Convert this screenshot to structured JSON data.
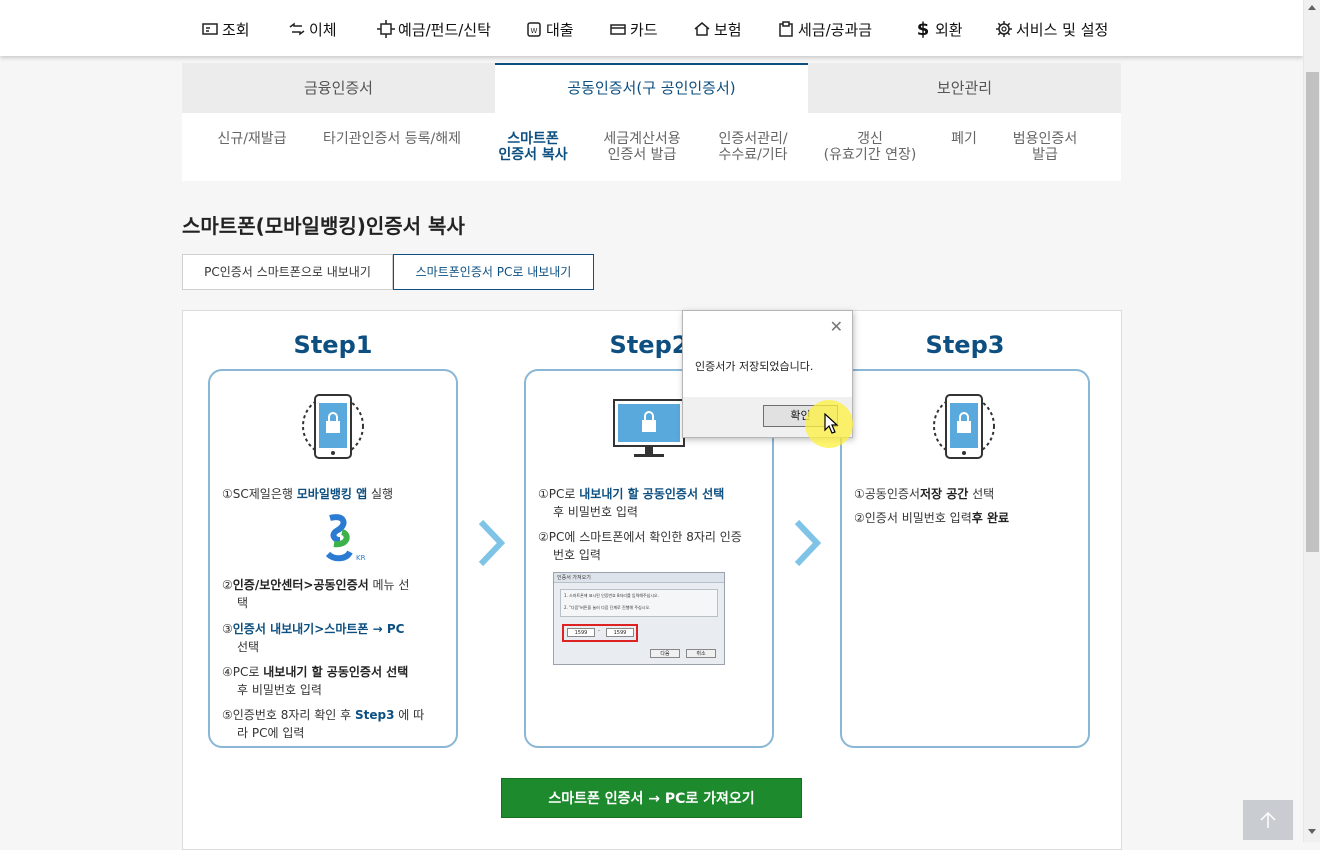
{
  "nav": {
    "items": [
      {
        "label": "조회",
        "icon": "inquiry-icon"
      },
      {
        "label": "이체",
        "icon": "transfer-icon"
      },
      {
        "label": "예금/펀드/신탁",
        "icon": "deposit-icon"
      },
      {
        "label": "대출",
        "icon": "loan-icon"
      },
      {
        "label": "카드",
        "icon": "card-icon"
      },
      {
        "label": "보험",
        "icon": "insurance-icon"
      },
      {
        "label": "세금/공과금",
        "icon": "tax-icon"
      },
      {
        "label": "외환",
        "icon": "dollar-icon"
      },
      {
        "label": "서비스 및 설정",
        "icon": "gear-icon"
      }
    ]
  },
  "main_tabs": [
    {
      "label": "금융인증서"
    },
    {
      "label": "공동인증서(구 공인인증서)"
    },
    {
      "label": "보안관리"
    }
  ],
  "sub_tabs": [
    {
      "line1": "신규/재발급",
      "line2": ""
    },
    {
      "line1": "타기관인증서 등록/해제",
      "line2": ""
    },
    {
      "line1": "스마트폰",
      "line2": "인증서 복사"
    },
    {
      "line1": "세금계산서용",
      "line2": "인증서 발급"
    },
    {
      "line1": "인증서관리/",
      "line2": "수수료/기타"
    },
    {
      "line1": "갱신",
      "line2": "(유효기간 연장)"
    },
    {
      "line1": "폐기",
      "line2": ""
    },
    {
      "line1": "범용인증서",
      "line2": "발급"
    }
  ],
  "page_title": "스마트폰(모바일뱅킹)인증서 복사",
  "content_tabs": [
    {
      "label": "PC인증서 스마트폰으로 내보내기"
    },
    {
      "label": "스마트폰인증서 PC로 내보내기"
    }
  ],
  "steps": [
    {
      "title": "Step1",
      "lines": {
        "l1a": "①SC제일은행 ",
        "l1b": "모바일뱅킹 앱",
        "l1c": " 실행",
        "l2a": "②",
        "l2b": "인증/보안센터>공동인증서",
        "l2c": " 메뉴 선",
        "l2d": "택",
        "l3a": "③",
        "l3b": "인증서 내보내기>스마트폰 → PC",
        "l3c": "선택",
        "l4a": "④PC로 ",
        "l4b": "내보내기 할 공동인증서 선택",
        "l4c": "후 비밀번호 입력",
        "l5a": "⑤인증번호 8자리 확인 후 ",
        "l5b": "Step3",
        "l5c": " 에 따",
        "l5d": "라 PC에 입력"
      },
      "logo_text": "KR"
    },
    {
      "title": "Step2",
      "lines": {
        "l1a": "①PC로 ",
        "l1b": "내보내기 할 공동인증서 선택",
        "l1c": "후 비밀번호 입력",
        "l2a": "②PC에 스마트폰에서 확인한 8자리 인증",
        "l2b": "번호 입력"
      },
      "mini": {
        "title": "인증서 가져오기",
        "t1": "1. 스마트폰에 표시된 인증번호 8자리를 입력해주십시오.",
        "t2": "2. \"다음\"버튼을 눌러 다음 단계로 진행해 주십시오.",
        "v1": "1599",
        "v2": "1599",
        "next": "다음",
        "cancel": "취소"
      }
    },
    {
      "title": "Step3",
      "lines": {
        "l1a": "①공동인증서",
        "l1b": "저장 공간",
        "l1c": " 선택",
        "l2a": "②인증서 비밀번호 입력",
        "l2b": "후 완료"
      }
    }
  ],
  "green_button": "스마트폰 인증서 → PC로 가져오기",
  "dialog": {
    "message": "인증서가 저장되었습니다.",
    "ok": "확인"
  }
}
